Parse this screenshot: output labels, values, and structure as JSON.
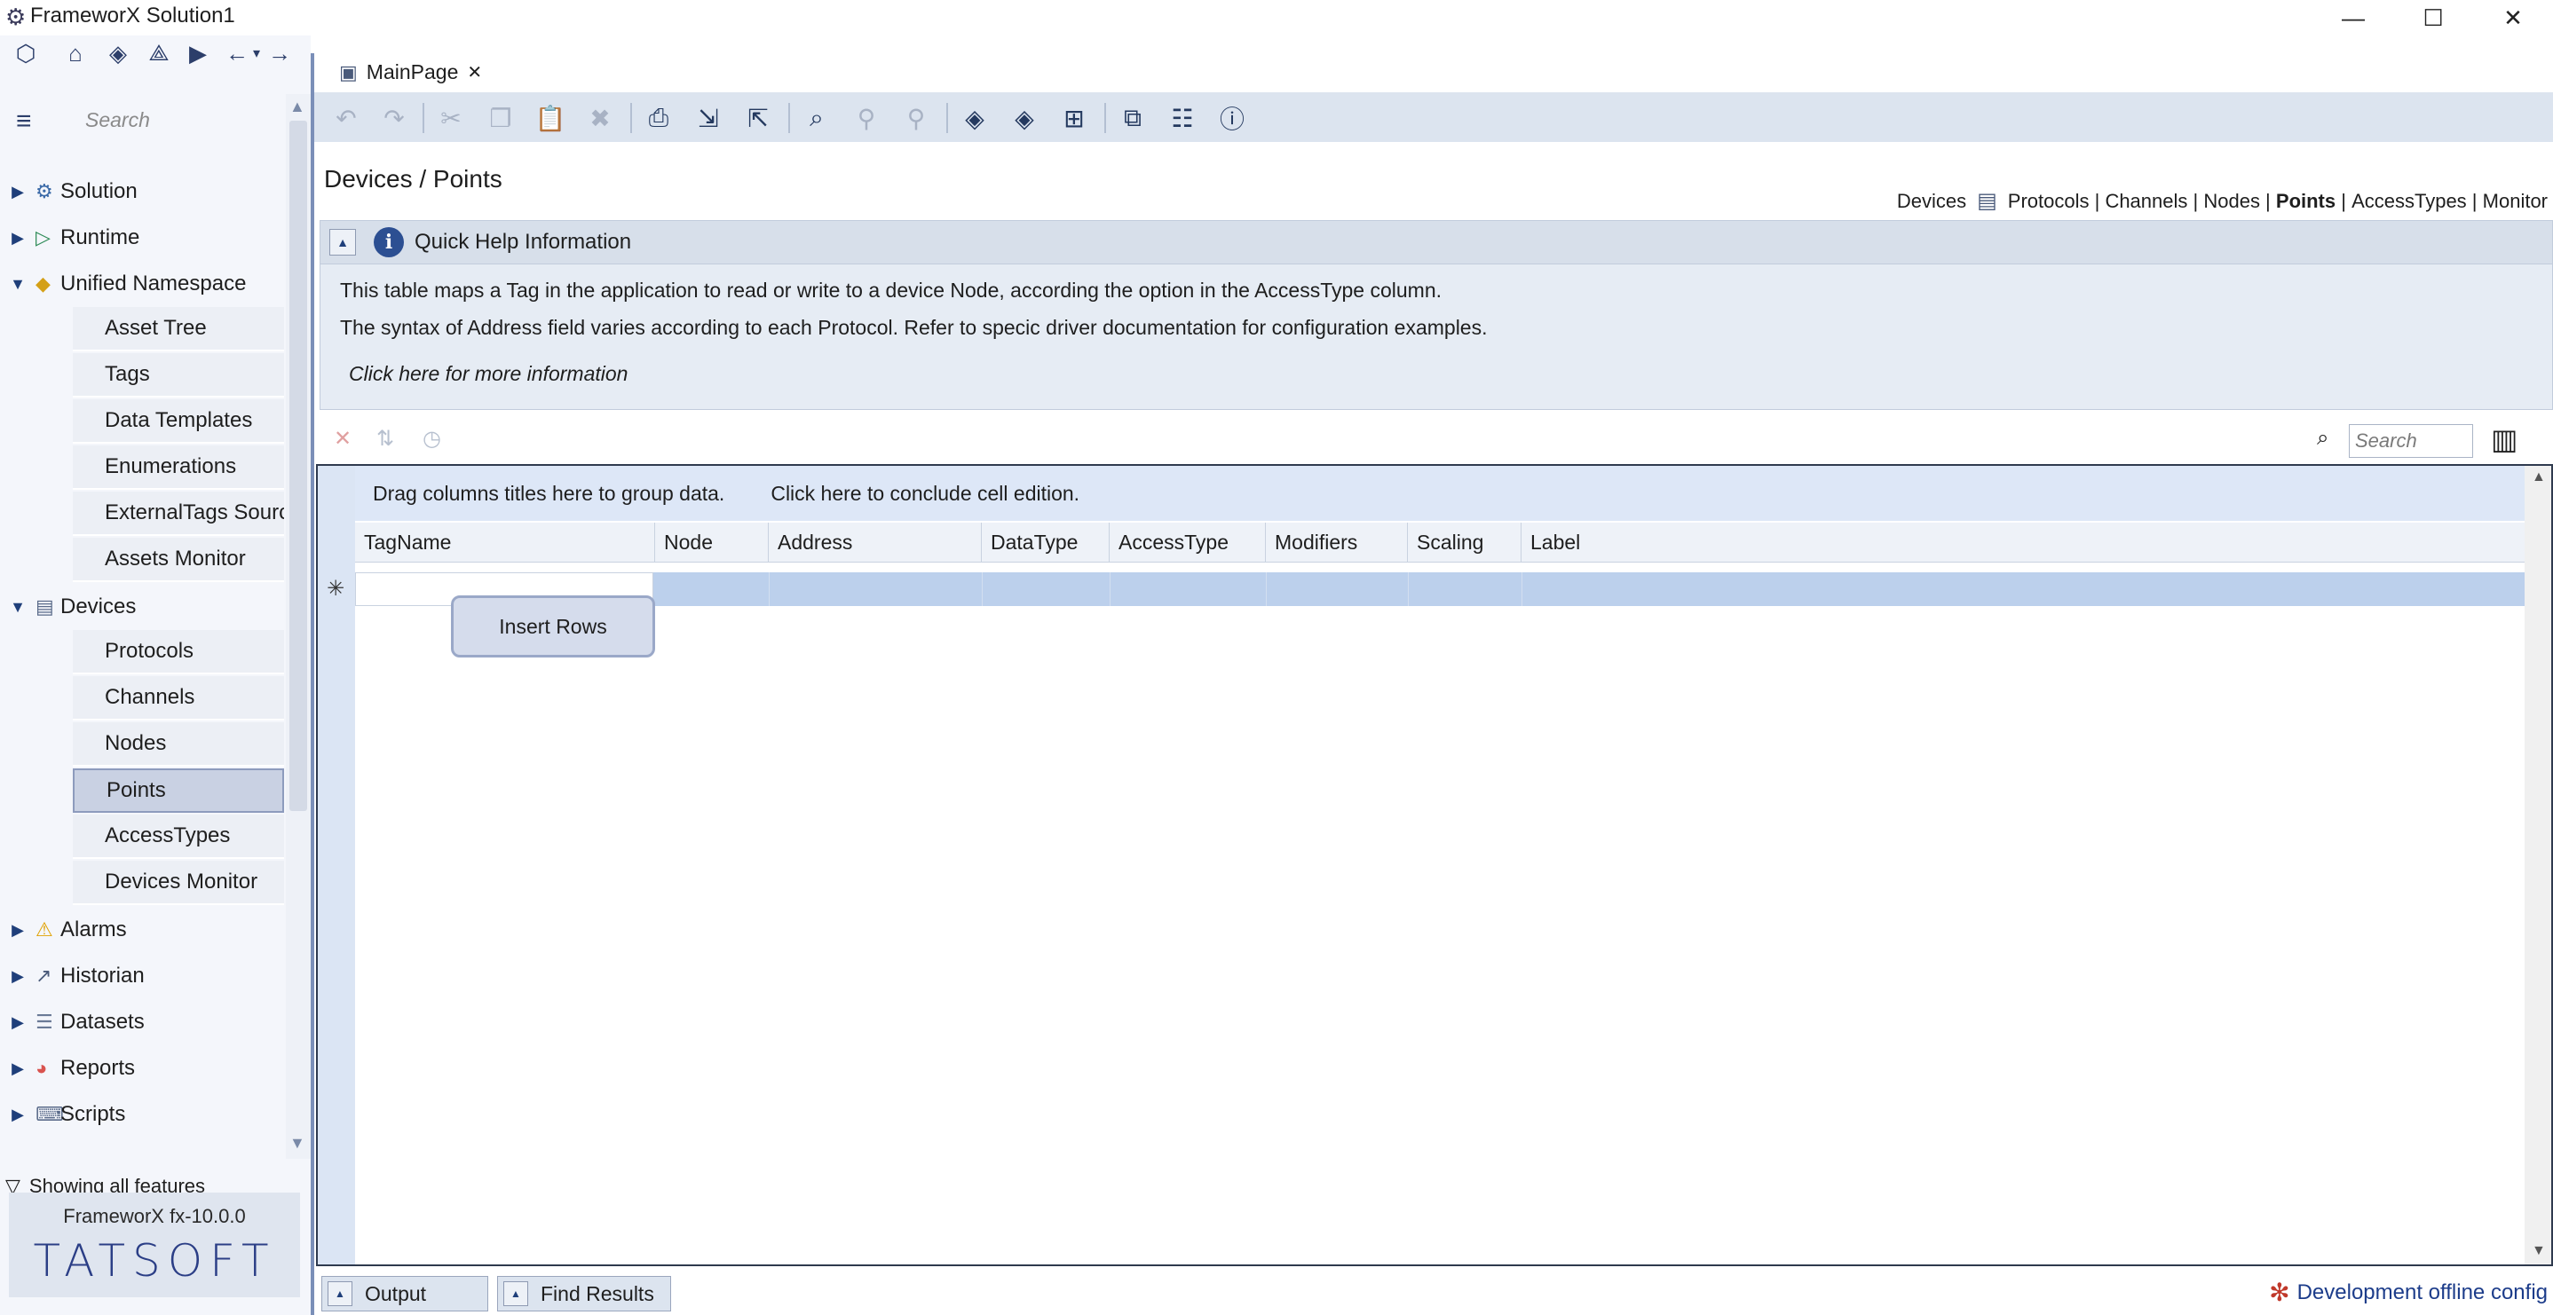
{
  "window": {
    "title": "FrameworX Solution1",
    "controls": [
      "minimize-icon",
      "maximize-icon",
      "close-icon"
    ]
  },
  "nav_toolbar": {
    "icons": [
      "solution-logo-icon",
      "home-icon",
      "tag-icon",
      "plugin-icon",
      "run-icon",
      "back-icon",
      "dropdown-icon",
      "forward-icon"
    ]
  },
  "sidebar": {
    "search_placeholder": "Search",
    "groups": [
      {
        "label": "Solution",
        "expanded": false,
        "items": []
      },
      {
        "label": "Runtime",
        "expanded": false,
        "items": []
      },
      {
        "label": "Unified Namespace",
        "expanded": true,
        "items": [
          "Asset Tree",
          "Tags",
          "Data Templates",
          "Enumerations",
          "ExternalTags Source",
          "Assets Monitor"
        ]
      },
      {
        "label": "Devices",
        "expanded": true,
        "items": [
          "Protocols",
          "Channels",
          "Nodes",
          "Points",
          "AccessTypes",
          "Devices Monitor"
        ]
      },
      {
        "label": "Alarms",
        "expanded": false,
        "items": []
      },
      {
        "label": "Historian",
        "expanded": false,
        "items": []
      },
      {
        "label": "Datasets",
        "expanded": false,
        "items": []
      },
      {
        "label": "Reports",
        "expanded": false,
        "items": []
      },
      {
        "label": "Scripts",
        "expanded": false,
        "items": []
      }
    ],
    "selected_item": "Points",
    "features_label": "Showing all features",
    "brand_version": "FrameworX fx-10.0.0",
    "brand_logo": "TATSOFT"
  },
  "tabs": [
    {
      "label": "MainPage",
      "active": true
    }
  ],
  "main_toolbar": {
    "icons": [
      "undo-icon",
      "redo-icon",
      "cut-icon",
      "copy-icon",
      "paste-icon",
      "delete-icon",
      "print-icon",
      "import-icon",
      "export-icon",
      "find-icon",
      "find-prev-icon",
      "find-next-icon",
      "add-tag-icon",
      "tag-settings-icon",
      "tree-icon",
      "open-external-icon",
      "comment-icon",
      "help-icon"
    ]
  },
  "page": {
    "title": "Devices / Points",
    "nav": {
      "section": "Devices",
      "links": [
        "Protocols",
        "Channels",
        "Nodes",
        "Points",
        "AccessTypes",
        "Monitor"
      ],
      "active": "Points",
      "separator": " | "
    }
  },
  "quick_help": {
    "title": "Quick Help Information",
    "line1": "This table maps a Tag in the application to read or write to a device Node, according the option in the AccessType column.",
    "line2": "The syntax of Address field varies according to each Protocol. Refer to specic driver documentation for configuration examples.",
    "link": "Click here for more information"
  },
  "grid": {
    "search_placeholder": "Search",
    "group_hint": "Drag columns titles here to group data.",
    "conclude_hint": "Click here to conclude cell edition.",
    "columns": [
      "TagName",
      "Node",
      "Address",
      "DataType",
      "AccessType",
      "Modifiers",
      "Scaling",
      "Label"
    ],
    "new_row_marker": "✳",
    "insert_rows_label": "Insert Rows"
  },
  "bottom": {
    "output_label": "Output",
    "find_results_label": "Find Results",
    "status": "Development offline config"
  }
}
